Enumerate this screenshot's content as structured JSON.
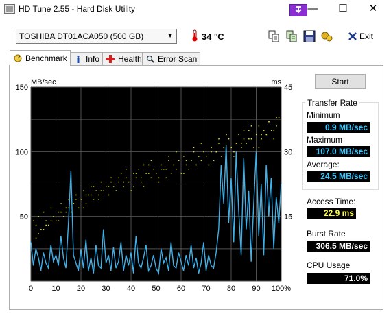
{
  "window": {
    "title": "HD Tune 2.55 - Hard Disk Utility",
    "minimize_glyph": "—",
    "maximize_glyph": "☐",
    "close_glyph": "✕"
  },
  "toolbar": {
    "device": "TOSHIBA DT01ACA050 (500 GB)",
    "temperature": "34 °C",
    "exit_label": "Exit"
  },
  "tabs": [
    {
      "label": "Benchmark",
      "icon": "benchmark-icon",
      "active": true
    },
    {
      "label": "Info",
      "icon": "info-icon"
    },
    {
      "label": "Health",
      "icon": "health-icon"
    },
    {
      "label": "Error Scan",
      "icon": "error-scan-icon"
    }
  ],
  "benchmark": {
    "start_label": "Start",
    "transfer_rate_title": "Transfer Rate",
    "minimum_label": "Minimum",
    "minimum_value": "0.9 MB/sec",
    "maximum_label": "Maximum",
    "maximum_value": "107.0 MB/sec",
    "average_label": "Average:",
    "average_value": "24.5 MB/sec",
    "access_time_label": "Access Time:",
    "access_time_value": "22.9 ms",
    "burst_rate_label": "Burst Rate",
    "burst_rate_value": "306.5 MB/sec",
    "cpu_usage_label": "CPU Usage",
    "cpu_usage_value": "71.0%"
  },
  "colors": {
    "transfer_line": "#3fb0e8",
    "access_points": "#e6e632",
    "plot_bg": "#000000",
    "grid": "#505050",
    "value_cyan": "#37c8ff",
    "value_yellow": "#ffff3c"
  },
  "chart_data": {
    "type": "line",
    "left_axis_unit": "MB/sec",
    "right_axis_unit": "ms",
    "ylim": [
      0,
      150
    ],
    "y2lim": [
      0,
      45
    ],
    "xlim": [
      0,
      100
    ],
    "y_ticks": [
      "150",
      "100",
      "50"
    ],
    "y2_ticks": [
      "45",
      "30",
      "15"
    ],
    "x_ticks": [
      "0",
      "10",
      "20",
      "30",
      "40",
      "50",
      "60",
      "70",
      "80",
      "90",
      "100%"
    ],
    "grid": true,
    "series": [
      {
        "kind": "line",
        "axis": "left",
        "x": [
          0,
          1,
          2,
          3,
          4,
          5,
          6,
          7,
          8,
          9,
          10,
          11,
          12,
          13,
          14,
          15,
          16,
          17,
          18,
          19,
          20,
          21,
          22,
          23,
          24,
          25,
          26,
          27,
          28,
          29,
          30,
          31,
          32,
          33,
          34,
          35,
          36,
          37,
          38,
          39,
          40,
          41,
          42,
          43,
          44,
          45,
          46,
          47,
          48,
          49,
          50,
          51,
          52,
          53,
          54,
          55,
          56,
          57,
          58,
          59,
          60,
          61,
          62,
          63,
          64,
          65,
          66,
          67,
          68,
          69,
          70,
          71,
          72,
          73,
          74,
          75,
          76,
          77,
          78,
          79,
          80,
          81,
          82,
          83,
          84,
          85,
          86,
          87,
          88,
          89,
          90,
          91,
          92,
          93,
          94,
          95,
          96,
          97,
          98,
          99,
          100
        ],
        "y": [
          30,
          12,
          25,
          18,
          8,
          22,
          14,
          10,
          28,
          15,
          20,
          12,
          35,
          18,
          10,
          45,
          85,
          20,
          14,
          8,
          25,
          10,
          32,
          8,
          18,
          6,
          28,
          12,
          10,
          40,
          14,
          20,
          8,
          26,
          10,
          15,
          30,
          8,
          20,
          12,
          22,
          6,
          35,
          14,
          10,
          18,
          28,
          8,
          12,
          20,
          10,
          6,
          25,
          14,
          18,
          8,
          30,
          12,
          10,
          22,
          15,
          8,
          20,
          12,
          28,
          10,
          18,
          6,
          14,
          30,
          8,
          20,
          12,
          10,
          22,
          40,
          90,
          60,
          105,
          45,
          80,
          30,
          100,
          55,
          20,
          95,
          40,
          70,
          15,
          60,
          100,
          35,
          75,
          20,
          90,
          50,
          80,
          25,
          65,
          45,
          75
        ]
      },
      {
        "kind": "scatter",
        "axis": "right",
        "x": [
          1,
          2,
          3,
          4,
          5,
          6,
          7,
          8,
          9,
          10,
          11,
          12,
          13,
          14,
          15,
          16,
          17,
          18,
          19,
          20,
          21,
          22,
          23,
          24,
          25,
          26,
          27,
          28,
          29,
          30,
          31,
          32,
          33,
          34,
          35,
          36,
          37,
          38,
          39,
          40,
          41,
          42,
          43,
          44,
          45,
          46,
          47,
          48,
          49,
          50,
          51,
          52,
          53,
          54,
          55,
          56,
          57,
          58,
          59,
          60,
          61,
          62,
          63,
          64,
          65,
          66,
          67,
          68,
          69,
          70,
          71,
          72,
          73,
          74,
          75,
          76,
          77,
          78,
          79,
          80,
          81,
          82,
          83,
          84,
          85,
          86,
          87,
          88,
          89,
          90,
          91,
          92,
          93,
          94,
          95,
          96,
          97,
          98,
          99,
          2,
          5,
          8,
          12,
          15,
          18,
          22,
          25,
          28,
          32,
          35,
          38,
          42,
          45,
          48,
          52,
          55,
          58,
          62,
          65,
          68,
          72,
          75,
          78,
          82,
          85,
          88,
          92,
          95,
          98,
          3,
          6,
          9,
          11,
          14,
          17,
          21,
          24,
          27,
          31,
          34,
          37,
          41,
          44,
          47,
          51,
          54,
          57,
          61,
          64,
          67,
          71,
          74,
          77,
          81,
          84,
          87,
          91,
          94,
          97
        ],
        "y": [
          14,
          13,
          15,
          12,
          16,
          14,
          13,
          17,
          15,
          14,
          16,
          18,
          15,
          17,
          19,
          16,
          18,
          20,
          17,
          19,
          21,
          18,
          20,
          22,
          19,
          21,
          20,
          23,
          21,
          22,
          20,
          24,
          22,
          21,
          23,
          25,
          22,
          24,
          23,
          21,
          25,
          24,
          26,
          23,
          22,
          25,
          27,
          24,
          26,
          25,
          23,
          27,
          26,
          24,
          28,
          25,
          27,
          26,
          28,
          25,
          29,
          27,
          26,
          28,
          30,
          27,
          29,
          28,
          30,
          29,
          27,
          31,
          28,
          30,
          32,
          29,
          31,
          30,
          33,
          31,
          30,
          32,
          34,
          31,
          33,
          32,
          35,
          33,
          31,
          34,
          36,
          33,
          35,
          34,
          37,
          35,
          33,
          36,
          38,
          10,
          12,
          14,
          16,
          17,
          19,
          20,
          22,
          21,
          23,
          24,
          26,
          25,
          27,
          28,
          26,
          29,
          30,
          28,
          31,
          32,
          30,
          33,
          34,
          32,
          35,
          36,
          34,
          37,
          38,
          11,
          13,
          15,
          14,
          16,
          18,
          17,
          20,
          19,
          22,
          21,
          23,
          22,
          24,
          25,
          24,
          26,
          27,
          25,
          28,
          29,
          27,
          30,
          31,
          29,
          32,
          33,
          31,
          34,
          35
        ]
      }
    ]
  }
}
